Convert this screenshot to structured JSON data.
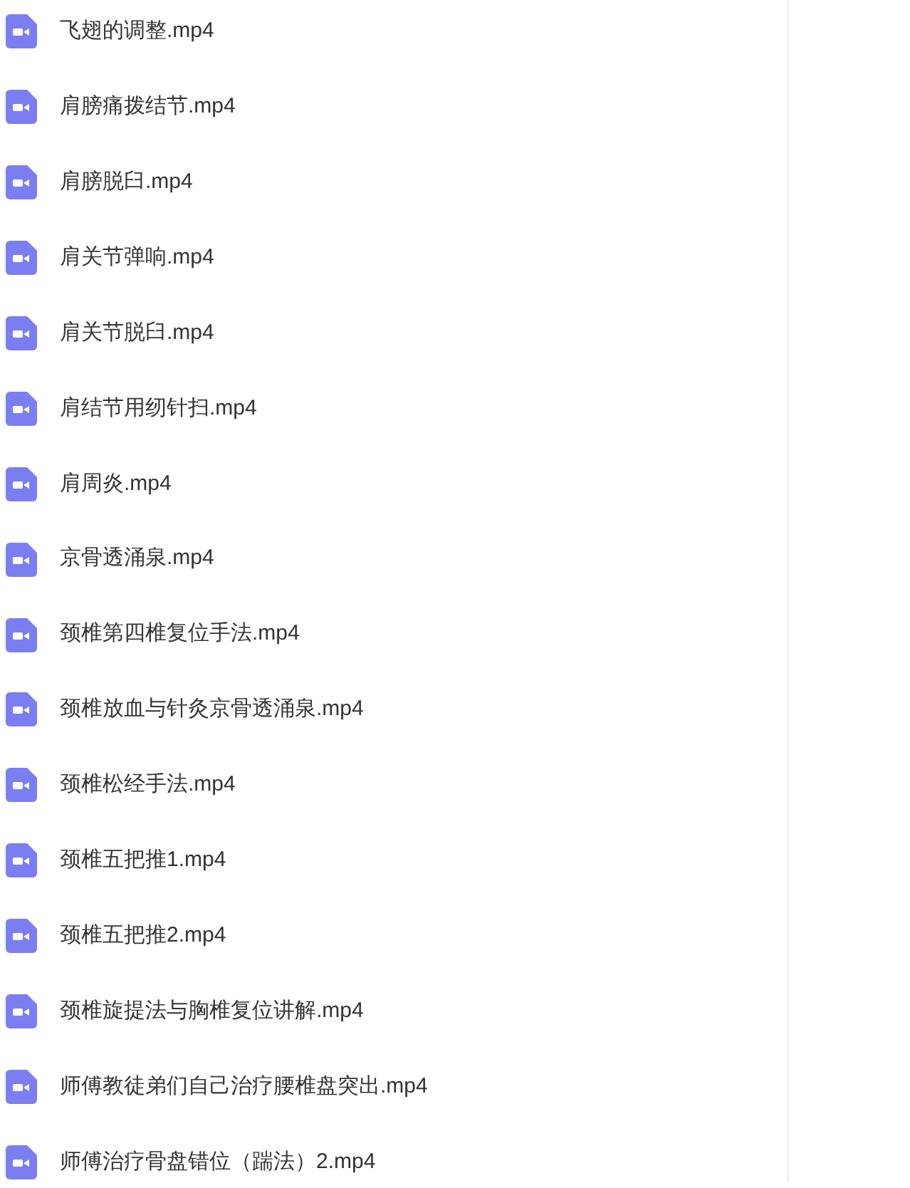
{
  "files": [
    {
      "name": "飞翅的调整.mp4"
    },
    {
      "name": "肩膀痛拨结节.mp4"
    },
    {
      "name": "肩膀脱臼.mp4"
    },
    {
      "name": "肩关节弹响.mp4"
    },
    {
      "name": "肩关节脱臼.mp4"
    },
    {
      "name": "肩结节用纫针扫.mp4"
    },
    {
      "name": "肩周炎.mp4"
    },
    {
      "name": "京骨透涌泉.mp4"
    },
    {
      "name": "颈椎第四椎复位手法.mp4"
    },
    {
      "name": "颈椎放血与针灸京骨透涌泉.mp4"
    },
    {
      "name": "颈椎松经手法.mp4"
    },
    {
      "name": "颈椎五把推1.mp4"
    },
    {
      "name": "颈椎五把推2.mp4"
    },
    {
      "name": "颈椎旋提法与胸椎复位讲解.mp4"
    },
    {
      "name": "师傅教徒弟们自己治疗腰椎盘突出.mp4"
    },
    {
      "name": "师傅治疗骨盘错位（踹法）2.mp4"
    }
  ]
}
